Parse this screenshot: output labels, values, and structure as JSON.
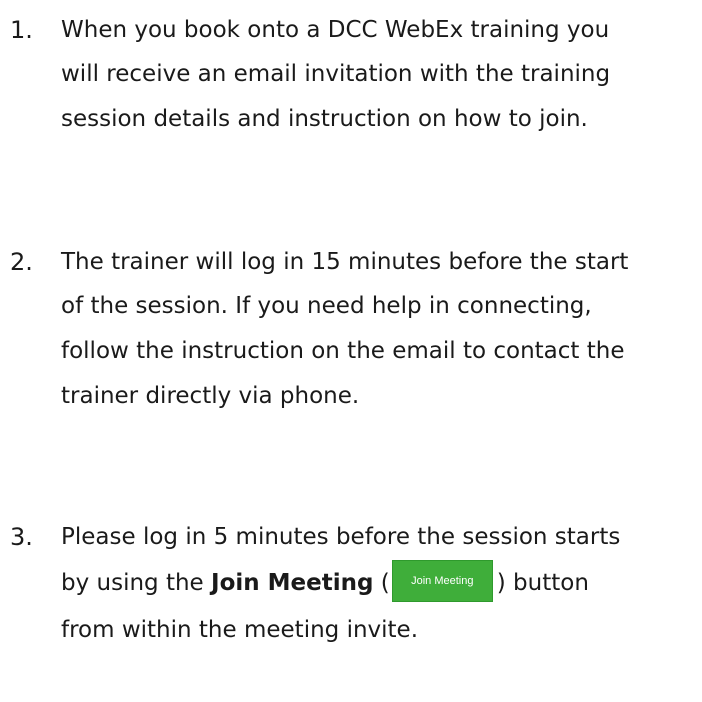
{
  "items": [
    {
      "number": "1.",
      "lines": [
        "When you book onto a DCC WebEx training you",
        "will receive an email invitation with the training",
        "session details and instruction on how to join."
      ]
    },
    {
      "number": "2.",
      "lines": [
        "The trainer will log in 15 minutes before the start",
        "of the session. If you need help in connecting,",
        "follow the instruction on the email to contact the",
        "trainer directly via phone."
      ]
    },
    {
      "number": "3.",
      "line1": "Please log in 5 minutes before the session starts",
      "line2_before": "by using the ",
      "line2_bold": "Join Meeting",
      "line2_open_paren": " (",
      "button_label": "Join Meeting",
      "line2_after": ") button",
      "line3": "from within the meeting invite."
    }
  ],
  "colors": {
    "button_background": "#3fae3a",
    "text": "#1a1a1a"
  }
}
